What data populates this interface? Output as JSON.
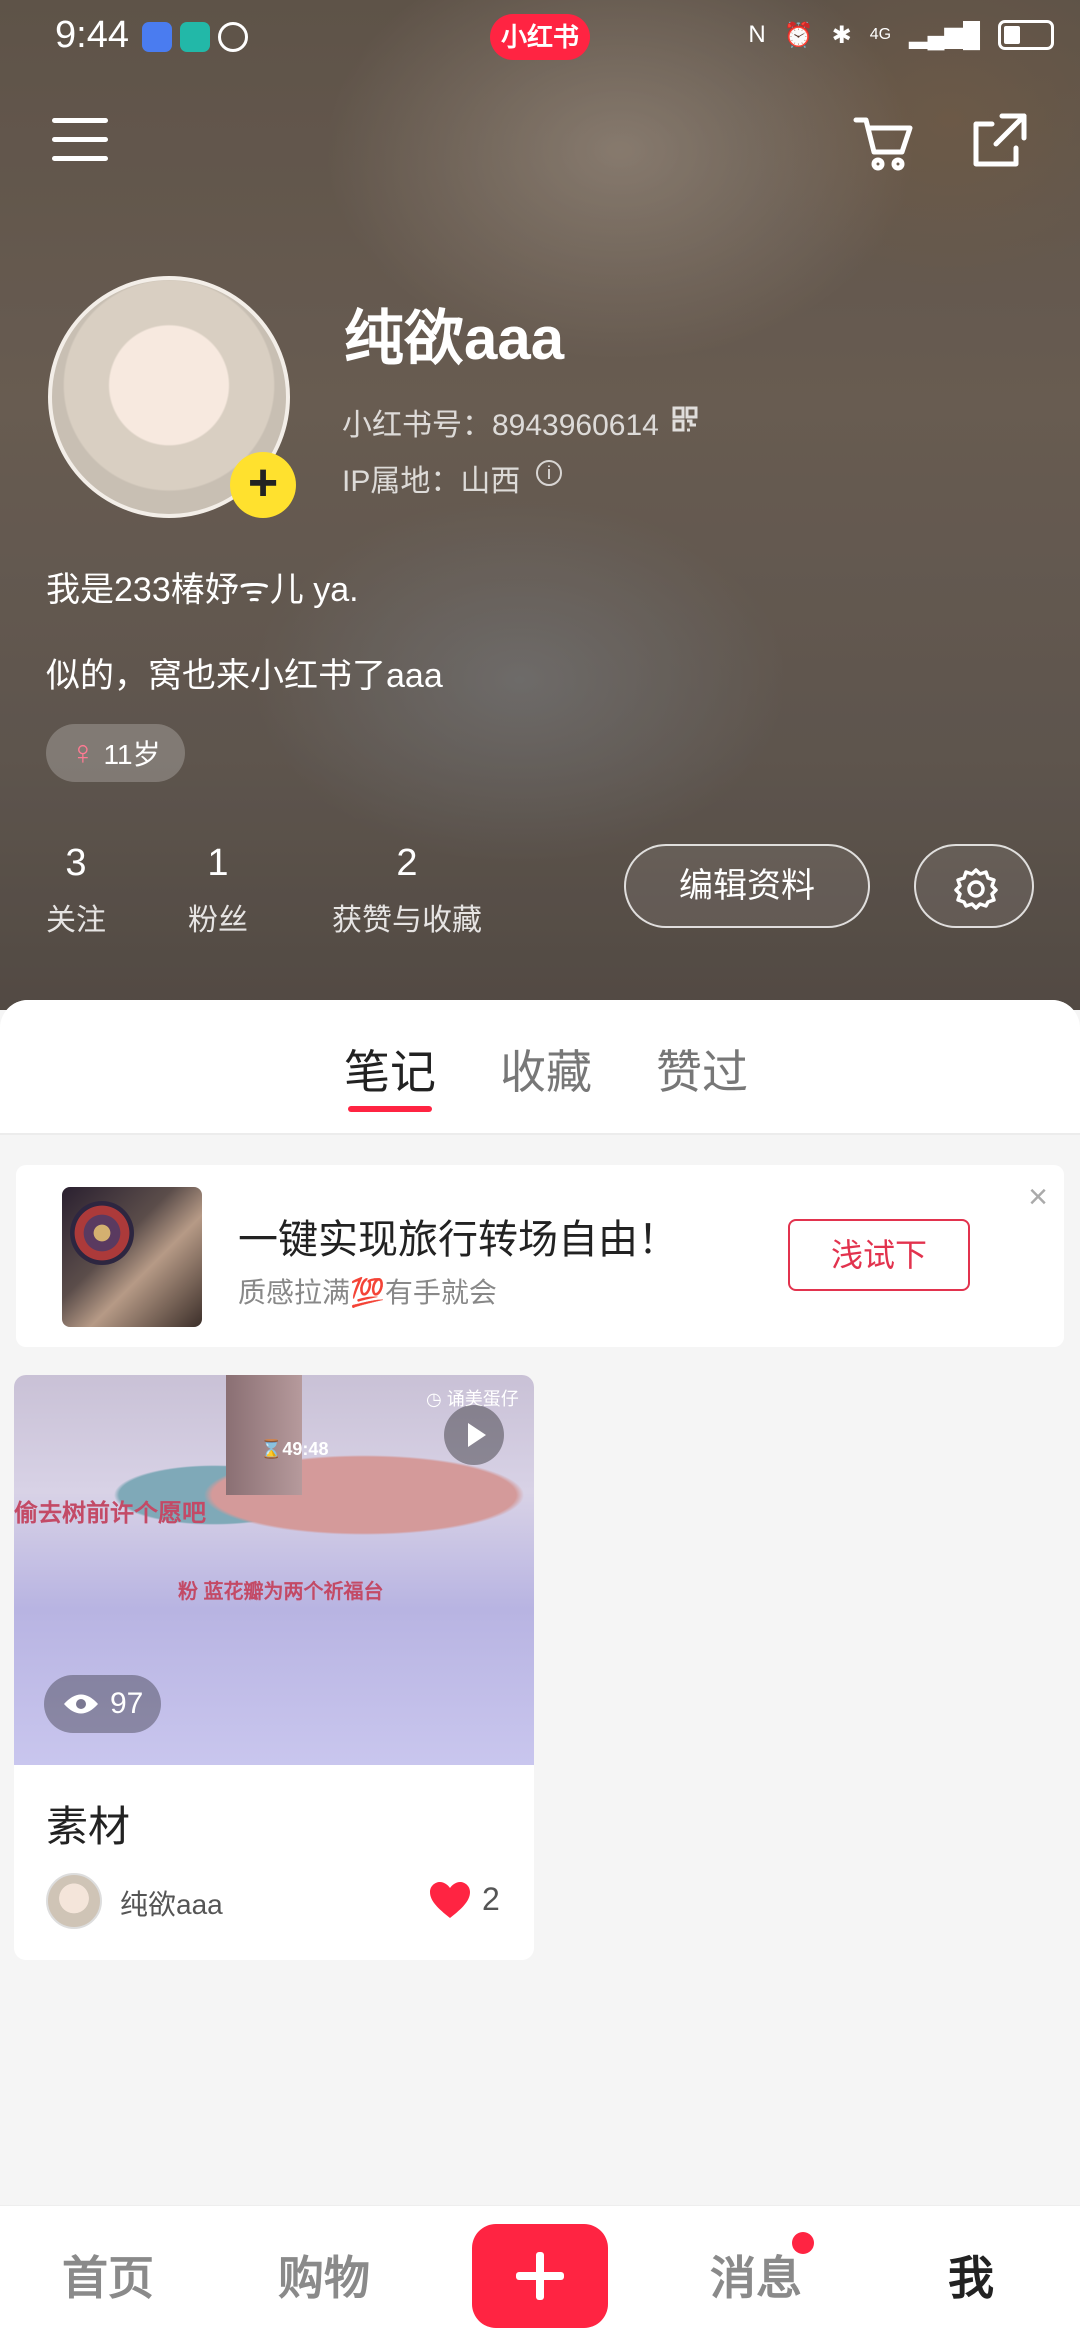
{
  "status_bar": {
    "time": "9:44",
    "brand_logo": "小红书",
    "network": "4G"
  },
  "header": {
    "menu_icon": "hamburger-menu-icon",
    "cart_icon": "shopping-cart-icon",
    "share_icon": "share-icon"
  },
  "profile": {
    "username": "纯欲aaa",
    "red_id": "小红书号：8943960614",
    "ip_location": "IP属地：山西",
    "bio_line1": "我是233椿妤ᯤ儿 ya.",
    "bio_line2": "似的，窝也来小红书了aaa",
    "gender_symbol": "♀",
    "age_tag": "11岁",
    "stats": [
      {
        "value": "3",
        "label": "关注"
      },
      {
        "value": "1",
        "label": "粉丝"
      },
      {
        "value": "2",
        "label": "获赞与收藏"
      }
    ],
    "edit_button": "编辑资料"
  },
  "tabs": [
    {
      "label": "笔记",
      "active": true
    },
    {
      "label": "收藏",
      "active": false
    },
    {
      "label": "赞过",
      "active": false
    }
  ],
  "ad": {
    "title": "一键实现旅行转场自由！",
    "subtitle": "质感拉满💯有手就会",
    "button": "浅试下",
    "close": "×"
  },
  "note": {
    "cover_text1": "偷去树前许个愿吧",
    "cover_text2": "粉 蓝花瓣为两个祈福台",
    "cover_timer": "⌛49:48",
    "cover_brand": "◷ 诵美蛋仔",
    "views": "97",
    "title": "素材",
    "author": "纯欲aaa",
    "likes": "2"
  },
  "bottom_nav": [
    {
      "label": "首页"
    },
    {
      "label": "购物"
    },
    {
      "label": "消息",
      "badge": true
    },
    {
      "label": "我",
      "active": true
    }
  ],
  "colors": {
    "accent": "#ff2442",
    "add_badge": "#ffe12e"
  }
}
